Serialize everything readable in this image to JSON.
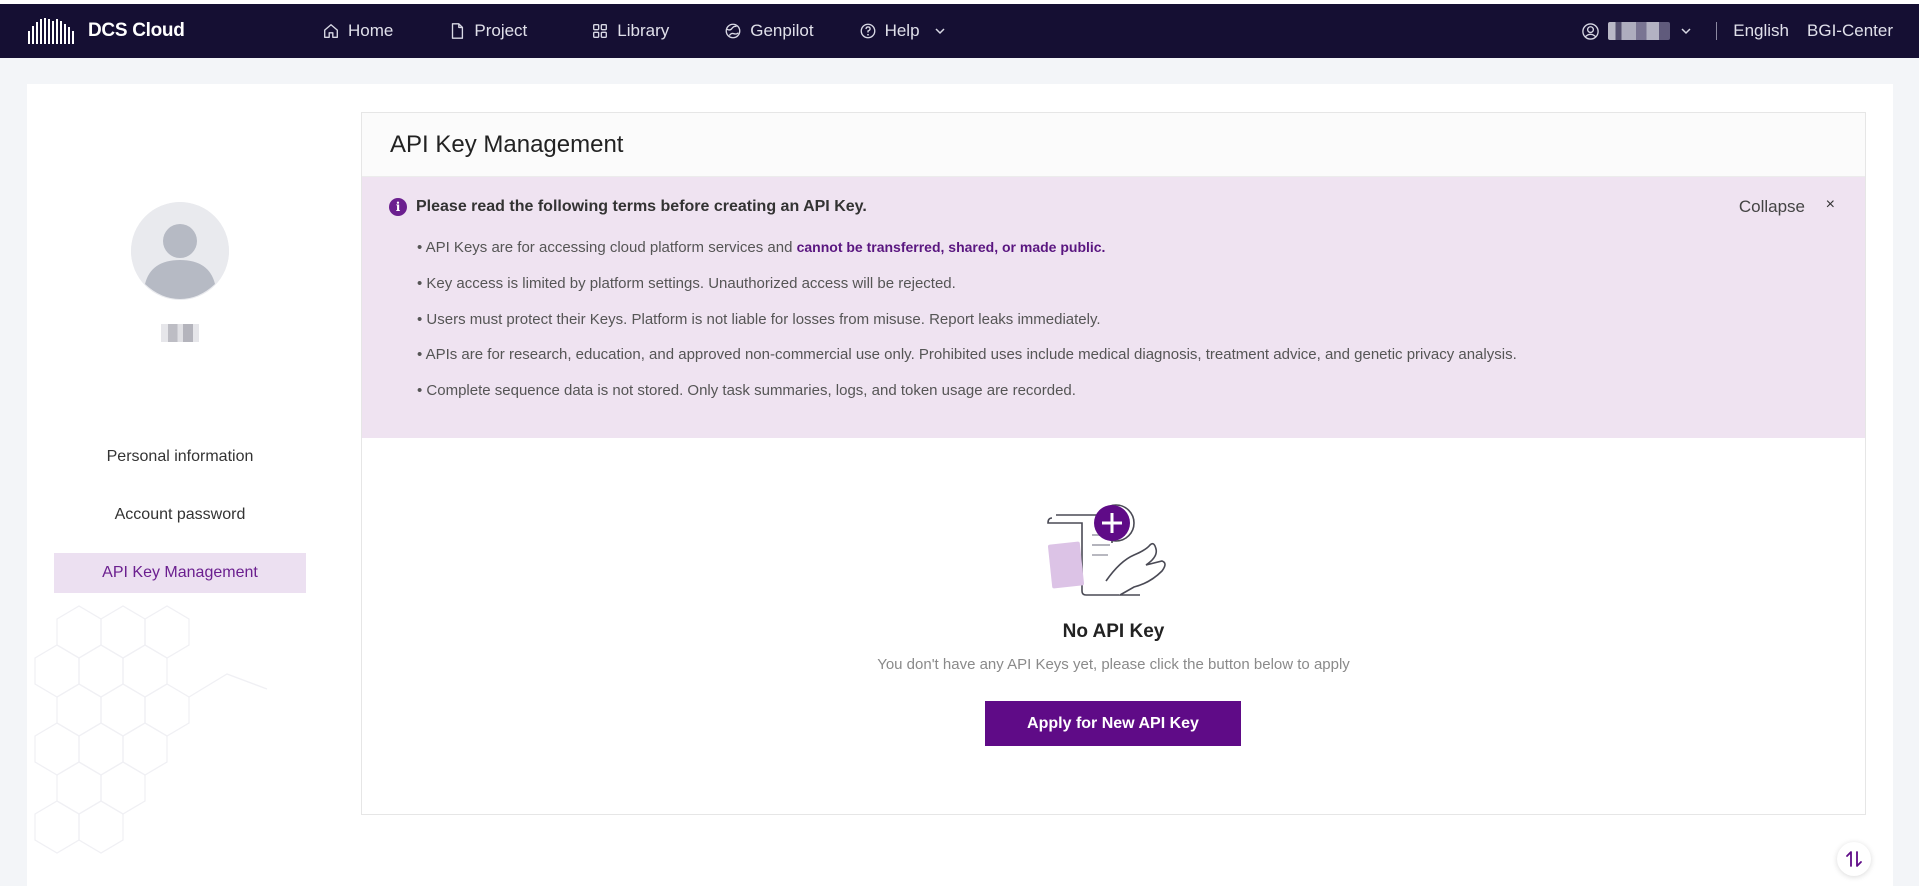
{
  "app": {
    "brand_name": "DCS Cloud"
  },
  "nav": {
    "items": [
      {
        "label": "Home",
        "icon": "home-icon"
      },
      {
        "label": "Project",
        "icon": "file-icon"
      },
      {
        "label": "Library",
        "icon": "grid-icon"
      },
      {
        "label": "Genpilot",
        "icon": "globe-icon"
      },
      {
        "label": "Help",
        "icon": "help-circle-icon"
      }
    ],
    "language": "English",
    "center": "BGI-Center"
  },
  "sidebar": {
    "items": [
      {
        "label": "Personal information",
        "active": false
      },
      {
        "label": "Account password",
        "active": false
      },
      {
        "label": "API Key Management",
        "active": true
      }
    ]
  },
  "page": {
    "title": "API Key Management",
    "terms": {
      "heading": "Please read the following terms before creating an API Key.",
      "collapse_label": "Collapse",
      "close_label": "×",
      "lines": [
        {
          "text": "• API Keys are for accessing cloud platform services and ",
          "highlight": "cannot be transferred, shared, or made public."
        },
        {
          "text": "• Key access is limited by platform settings. Unauthorized access will be rejected."
        },
        {
          "text": "• Users must protect their Keys. Platform is not liable for losses from misuse. Report leaks immediately."
        },
        {
          "text": "• APIs are for research, education, and approved non-commercial use only. Prohibited uses include medical diagnosis, treatment advice, and genetic privacy analysis."
        },
        {
          "text": "• Complete sequence data is not stored. Only task summaries, logs, and token usage are recorded."
        }
      ]
    },
    "empty": {
      "title": "No API Key",
      "subtitle": "You don't have any API Keys yet, please click the button below to apply",
      "button_label": "Apply for New API Key"
    }
  },
  "colors": {
    "topbar_bg": "#150f33",
    "accent": "#5f0b87",
    "terms_bg": "#efe3f1",
    "active_item_bg": "#ece0f1"
  }
}
